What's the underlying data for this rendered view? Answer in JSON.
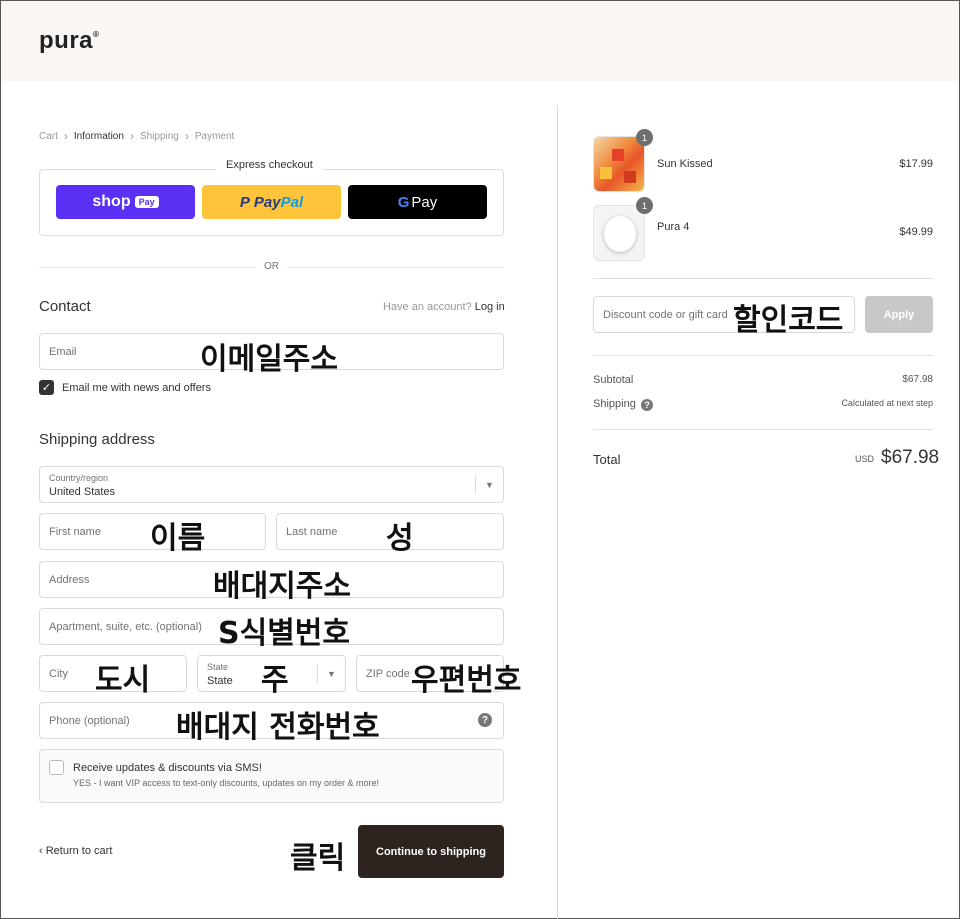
{
  "header": {
    "logo": "pura",
    "logo_mark": "®"
  },
  "breadcrumb": [
    "Cart",
    "Information",
    "Shipping",
    "Payment"
  ],
  "express": {
    "title": "Express checkout",
    "shop": {
      "label": "shop",
      "pill": "Pay"
    },
    "paypal": {
      "label_a": "Pay",
      "label_b": "Pal"
    },
    "gpay": {
      "g": "G",
      "label": "Pay"
    },
    "or": "OR"
  },
  "contact": {
    "title": "Contact",
    "have_account": "Have an account?",
    "login": "Log in",
    "email_placeholder": "Email",
    "email_annotation": "이메일주소",
    "newsletter_label": "Email me with news and offers"
  },
  "shipping": {
    "title": "Shipping address",
    "country_label": "Country/region",
    "country_value": "United States",
    "first_name": "First name",
    "first_name_annotation": "이름",
    "last_name": "Last name",
    "last_name_annotation": "성",
    "address": "Address",
    "address_annotation": "배대지주소",
    "apartment": "Apartment, suite, etc. (optional)",
    "apartment_annotation": "S식별번호",
    "city": "City",
    "city_annotation": "도시",
    "state_label": "State",
    "state_value": "State",
    "state_annotation": "주",
    "zip": "ZIP code",
    "zip_annotation": "우편번호",
    "phone": "Phone (optional)",
    "phone_annotation": "배대지 전화번호",
    "help": "?"
  },
  "sms": {
    "title": "Receive updates & discounts via SMS!",
    "subtitle": "YES - I want VIP access to text-only discounts, updates on my order & more!"
  },
  "footer": {
    "return": "Return to cart",
    "click_annotation": "클릭",
    "continue": "Continue to shipping"
  },
  "order": {
    "items": [
      {
        "name": "Sun Kissed",
        "price": "$17.99",
        "qty": "1"
      },
      {
        "name": "Pura 4",
        "price": "$49.99",
        "qty": "1"
      }
    ],
    "discount_placeholder": "Discount code or gift card",
    "discount_annotation": "할인코드",
    "apply": "Apply",
    "subtotal_label": "Subtotal",
    "subtotal_value": "$67.98",
    "shipping_label": "Shipping",
    "shipping_value": "Calculated at next step",
    "total_label": "Total",
    "currency": "USD",
    "total_value": "$67.98"
  }
}
